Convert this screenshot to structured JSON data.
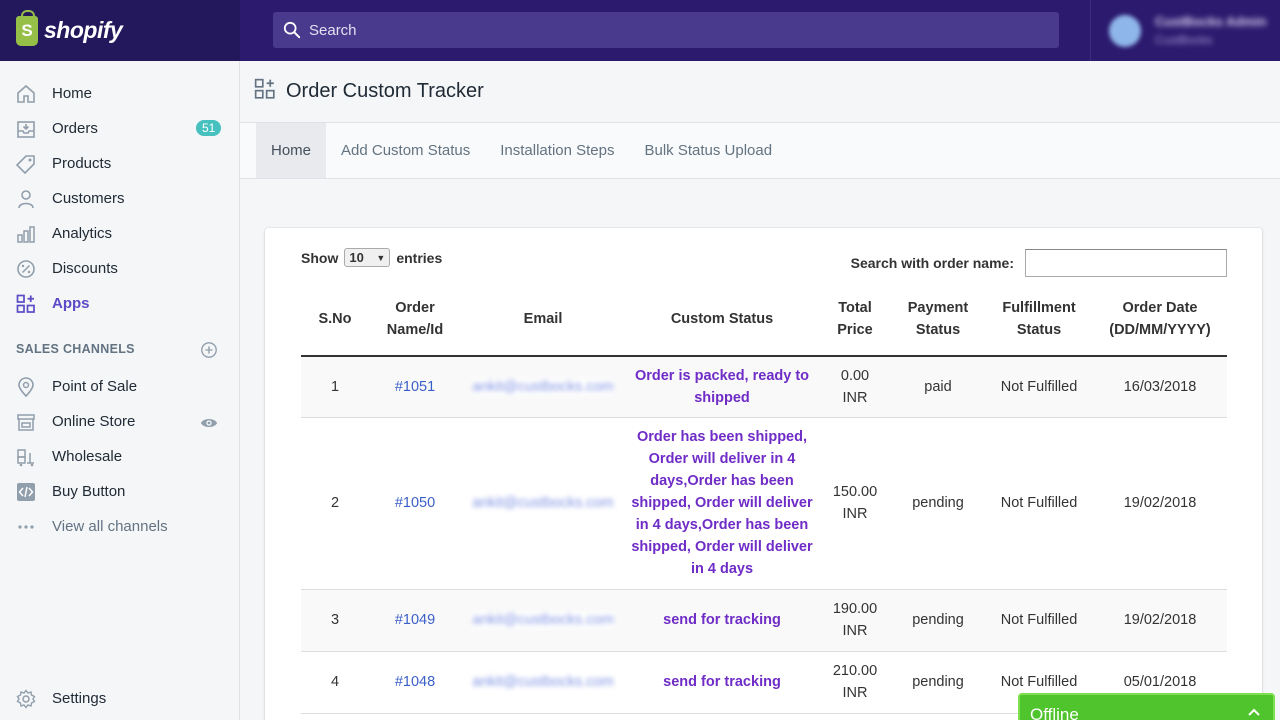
{
  "topbar": {
    "logo_text": "shopify",
    "logo_glyph": "S",
    "search_placeholder": "Search",
    "user_name": "CustBocks Admin",
    "user_shop": "CustBocks"
  },
  "sidebar": {
    "items": [
      {
        "label": "Home",
        "icon": "home-icon"
      },
      {
        "label": "Orders",
        "icon": "orders-icon",
        "badge": "51"
      },
      {
        "label": "Products",
        "icon": "tag-icon"
      },
      {
        "label": "Customers",
        "icon": "person-icon"
      },
      {
        "label": "Analytics",
        "icon": "analytics-icon"
      },
      {
        "label": "Discounts",
        "icon": "discount-icon"
      },
      {
        "label": "Apps",
        "icon": "apps-icon",
        "active": true
      }
    ],
    "sales_channels_heading": "SALES CHANNELS",
    "channels": [
      {
        "label": "Point of Sale",
        "icon": "location-pin-icon"
      },
      {
        "label": "Online Store",
        "icon": "store-icon"
      },
      {
        "label": "Wholesale",
        "icon": "wholesale-icon"
      },
      {
        "label": "Buy Button",
        "icon": "code-icon"
      }
    ],
    "view_all": "View all channels",
    "settings": "Settings"
  },
  "page": {
    "title": "Order Custom Tracker",
    "tabs": [
      "Home",
      "Add Custom Status",
      "Installation Steps",
      "Bulk Status Upload"
    ],
    "active_tab": "Home"
  },
  "table_controls": {
    "show_label": "Show",
    "entries_value": "10",
    "entries_label": "entries",
    "search_label": "Search with order name:"
  },
  "table": {
    "headers": {
      "sno": "S.No",
      "order_a": "Order",
      "order_b": "Name/Id",
      "email": "Email",
      "custom_status": "Custom Status",
      "total_a": "Total",
      "total_b": "Price",
      "payment_a": "Payment",
      "payment_b": "Status",
      "fulfill_a": "Fulfillment",
      "fulfill_b": "Status",
      "date_a": "Order Date",
      "date_b": "(DD/MM/YYYY)"
    },
    "rows": [
      {
        "sno": "1",
        "order": "#1051",
        "email": "ankit@custbocks.com",
        "status": "Order is packed, ready to shipped",
        "price_a": "0.00",
        "price_b": "INR",
        "payment": "paid",
        "fulfillment": "Not Fulfilled",
        "date": "16/03/2018"
      },
      {
        "sno": "2",
        "order": "#1050",
        "email": "ankit@custbocks.com",
        "status": "Order has been shipped, Order will deliver in 4 days,Order has been shipped, Order will deliver in 4 days,Order has been shipped, Order will deliver in 4 days",
        "price_a": "150.00",
        "price_b": "INR",
        "payment": "pending",
        "fulfillment": "Not Fulfilled",
        "date": "19/02/2018"
      },
      {
        "sno": "3",
        "order": "#1049",
        "email": "ankit@custbocks.com",
        "status": "send for tracking",
        "price_a": "190.00",
        "price_b": "INR",
        "payment": "pending",
        "fulfillment": "Not Fulfilled",
        "date": "19/02/2018"
      },
      {
        "sno": "4",
        "order": "#1048",
        "email": "ankit@custbocks.com",
        "status": "send for tracking",
        "price_a": "210.00",
        "price_b": "INR",
        "payment": "pending",
        "fulfillment": "Not Fulfilled",
        "date": "05/01/2018"
      }
    ]
  },
  "chat": {
    "label": "Offline"
  },
  "colors": {
    "topbar": "#2c1a6e",
    "accent": "#5c4ac7",
    "status_text": "#6f2cc6",
    "badge": "#47c1bf",
    "offline": "#4fc42d"
  }
}
